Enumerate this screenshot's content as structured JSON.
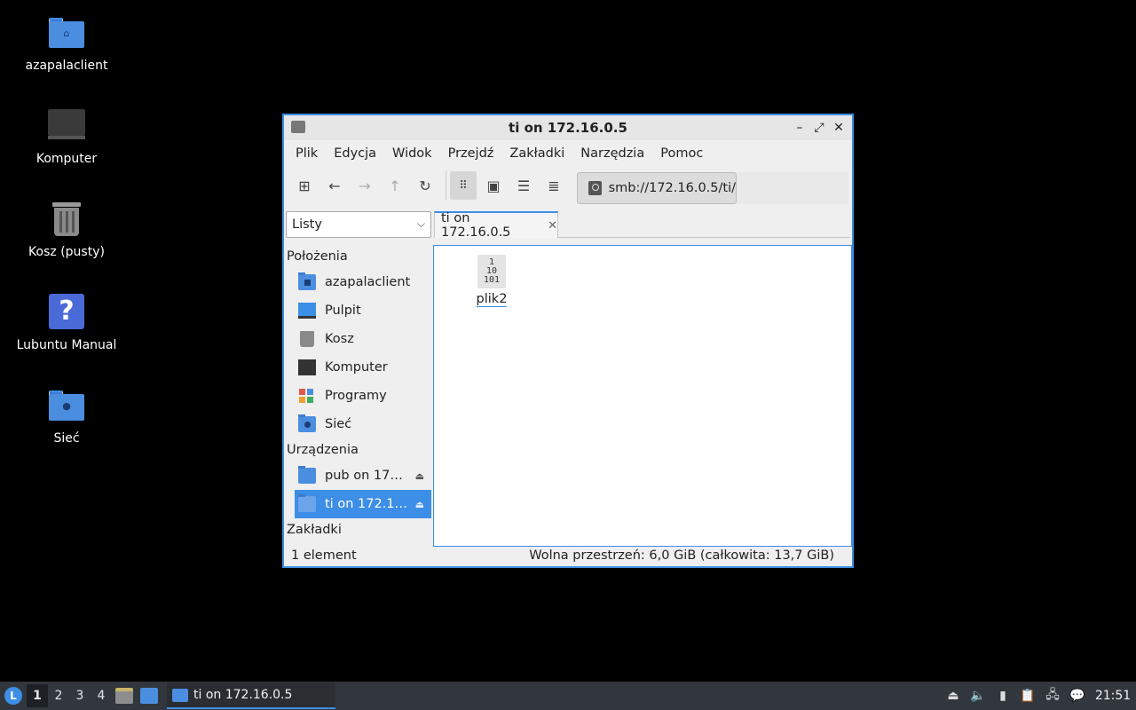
{
  "desktop": {
    "icons": [
      {
        "label": "azapalaclient",
        "icon": "home-folder-icon"
      },
      {
        "label": "Komputer",
        "icon": "computer-icon"
      },
      {
        "label": "Kosz (pusty)",
        "icon": "trash-icon"
      },
      {
        "label": "Lubuntu Manual",
        "icon": "help-icon"
      },
      {
        "label": "Sieć",
        "icon": "network-folder-icon"
      }
    ]
  },
  "window": {
    "title": "ti on 172.16.0.5",
    "menu": [
      "Plik",
      "Edycja",
      "Widok",
      "Przejdź",
      "Zakładki",
      "Narzędzia",
      "Pomoc"
    ],
    "address": "smb://172.16.0.5/ti/",
    "side_pane_mode": "Listy",
    "tab_label": "ti on 172.16.0.5",
    "sidebar": {
      "places_header": "Położenia",
      "places": [
        "azapalaclient",
        "Pulpit",
        "Kosz",
        "Komputer",
        "Programy",
        "Sieć"
      ],
      "devices_header": "Urządzenia",
      "devices": [
        "pub on 17…",
        "ti on 172.1…"
      ],
      "bookmarks_header": "Zakładki"
    },
    "files": [
      {
        "name": "plik2",
        "icon": "binary-file-icon",
        "glyph": "1\n10\n101"
      }
    ],
    "status": {
      "count": "1 element",
      "space": "Wolna przestrzeń: 6,0 GiB (całkowita: 13,7 GiB)"
    }
  },
  "taskbar": {
    "workspaces": [
      "1",
      "2",
      "3",
      "4"
    ],
    "task_label": "ti on 172.16.0.5",
    "clock": "21:51"
  },
  "colors": {
    "accent": "#3c8ee6",
    "folder": "#4b8ee0",
    "taskbar": "#32373d"
  }
}
